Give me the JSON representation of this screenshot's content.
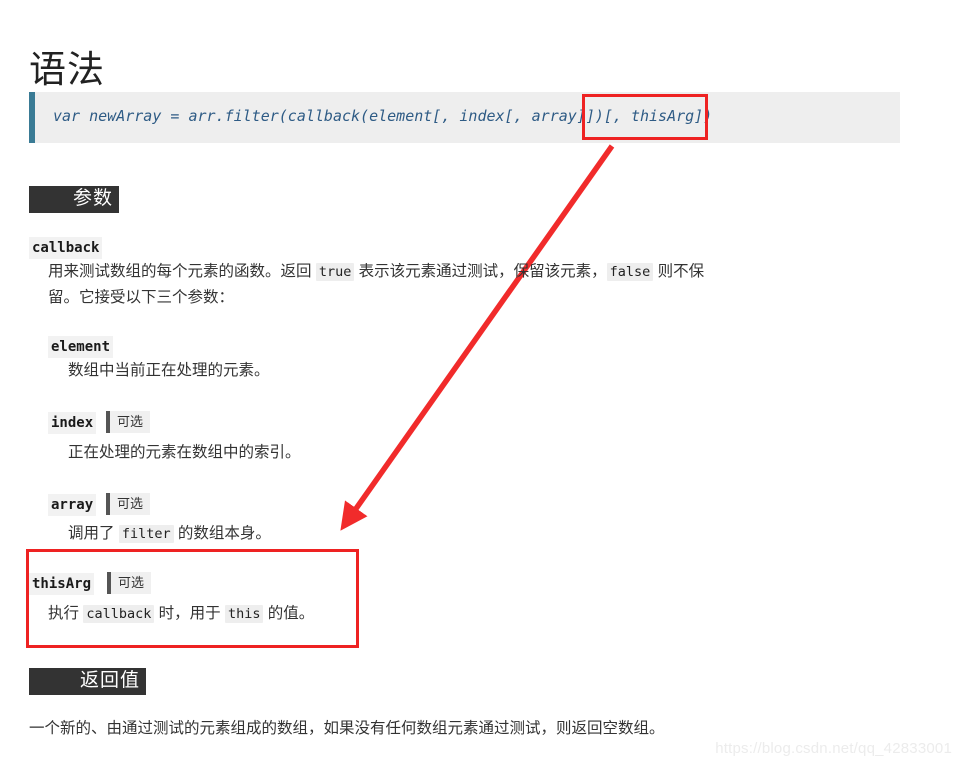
{
  "page": {
    "title": "语法"
  },
  "syntax": {
    "code": "var newArray = arr.filter(callback(element[, index[, array]])[, thisArg])",
    "highlight_fragment": "[, thisArg])"
  },
  "sections": {
    "params_heading": "参数",
    "return_heading": "返回值"
  },
  "params": {
    "callback": {
      "term": "callback",
      "desc_part1": "用来测试数组的每个元素的函数。返回 ",
      "code_true": "true",
      "desc_part2": " 表示该元素通过测试，保留该元素，",
      "code_false": "false",
      "desc_part3": " 则不保留。它接受以下三个参数："
    },
    "element": {
      "term": "element",
      "desc": "数组中当前正在处理的元素。"
    },
    "index": {
      "term": "index",
      "optional_badge": "可选",
      "desc": "正在处理的元素在数组中的索引。"
    },
    "array": {
      "term": "array",
      "optional_badge": "可选",
      "desc_part1": "调用了 ",
      "code_filter": "filter",
      "desc_part2": " 的数组本身。"
    },
    "thisArg": {
      "term": "thisArg",
      "optional_badge": "可选",
      "desc_part1": "执行 ",
      "code_callback": "callback",
      "desc_part2": " 时，用于 ",
      "code_this": "this",
      "desc_part3": " 的值。"
    }
  },
  "return_value": {
    "desc": "一个新的、由通过测试的元素组成的数组，如果没有任何数组元素通过测试，则返回空数组。"
  },
  "watermark": {
    "text": "https://blog.csdn.net/qq_42833001"
  },
  "colors": {
    "accent_code_border": "#3a7b95",
    "code_background": "#eeeeee",
    "heading_background": "#333333",
    "annotation_red": "#ee2222",
    "code_text": "#2e5b85"
  }
}
